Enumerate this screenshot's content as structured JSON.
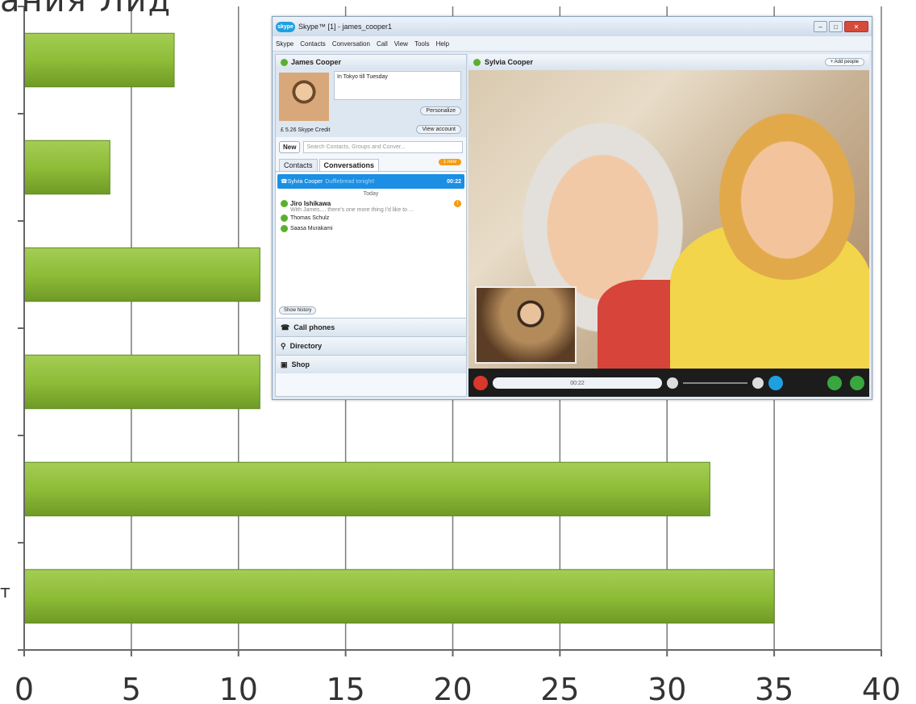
{
  "chart_data": {
    "type": "bar",
    "orientation": "horizontal",
    "title": "",
    "categories": [
      "",
      "",
      "",
      "",
      "",
      ""
    ],
    "values": [
      7,
      4,
      11,
      11,
      32,
      35
    ],
    "xlim": [
      0,
      40
    ],
    "xticks": [
      "0",
      "5",
      "10",
      "15",
      "20",
      "25",
      "30",
      "35",
      "40"
    ],
    "grid": "vertical",
    "bar_color": "#8fbe3a"
  },
  "cut_title": "ания Лид",
  "cut_category": "т",
  "skype": {
    "title": "Skype™ [1] - james_cooper1",
    "logo": "skype",
    "menu": [
      "Skype",
      "Contacts",
      "Conversation",
      "Call",
      "View",
      "Tools",
      "Help"
    ],
    "user_name": "James Cooper",
    "mood": "In Tokyo till Tuesday",
    "personalize": "Personalize",
    "credit": "£ 5.26 Skype Credit",
    "view_account": "View account",
    "new_button": "New",
    "search_placeholder": "Search Contacts, Groups and Conver...",
    "tab_contacts": "Contacts",
    "tab_conversations": "Conversations",
    "new_badge": "1 new",
    "active_name": "Sylvia Cooper",
    "active_mood": "Dufflebread tonight!",
    "active_time": "00:22",
    "today": "Today",
    "contacts": [
      {
        "name": "Jiro Ishikawa",
        "sub": "With James.... there's one more thing I'd like to ..."
      },
      {
        "name": "Thomas Schulz",
        "sub": ""
      },
      {
        "name": "Saasa Murakami",
        "sub": ""
      }
    ],
    "show_history": "Show history",
    "nav": [
      "Call phones",
      "Directory",
      "Shop"
    ],
    "call_name": "Sylvia Cooper",
    "add_people": "+ Add people",
    "call_timer": "00:22"
  }
}
